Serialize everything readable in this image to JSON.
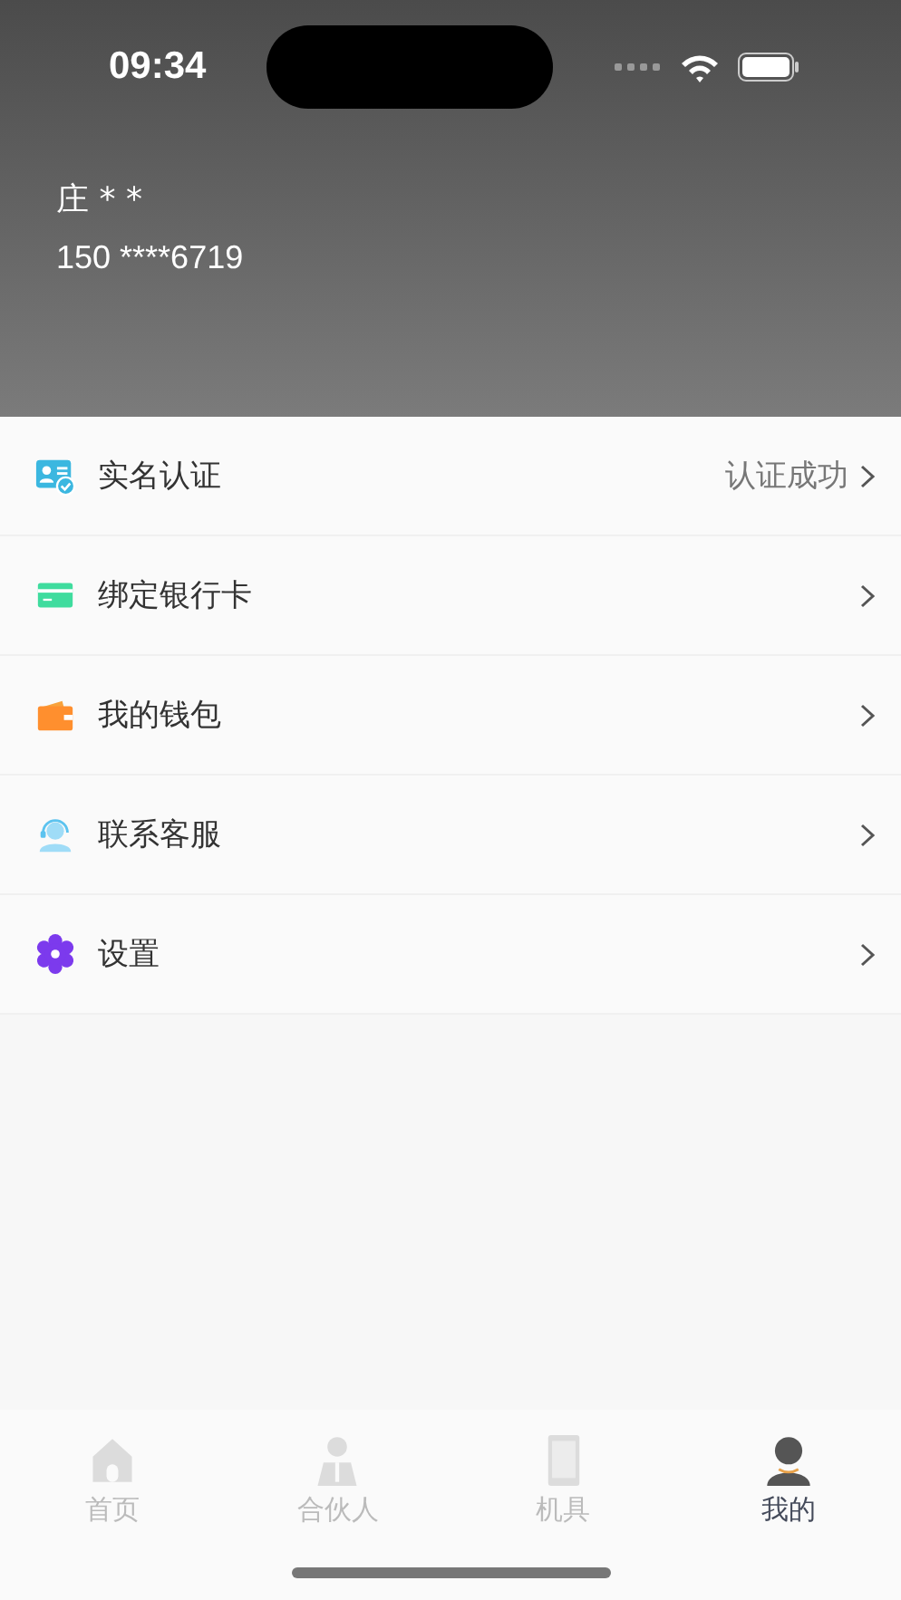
{
  "status_bar": {
    "time": "09:34"
  },
  "profile": {
    "name": "庄 * *",
    "phone": "150 ****6719"
  },
  "menu": [
    {
      "kind": "verify",
      "label": "实名认证",
      "value": "认证成功"
    },
    {
      "kind": "card",
      "label": "绑定银行卡"
    },
    {
      "kind": "wallet",
      "label": "我的钱包"
    },
    {
      "kind": "service",
      "label": "联系客服"
    },
    {
      "kind": "settings",
      "label": "设置"
    }
  ],
  "tabs": [
    {
      "kind": "home",
      "label": "首页",
      "selected": false
    },
    {
      "kind": "partner",
      "label": "合伙人",
      "selected": false
    },
    {
      "kind": "device",
      "label": "机具",
      "selected": false
    },
    {
      "kind": "me",
      "label": "我的",
      "selected": true
    }
  ]
}
